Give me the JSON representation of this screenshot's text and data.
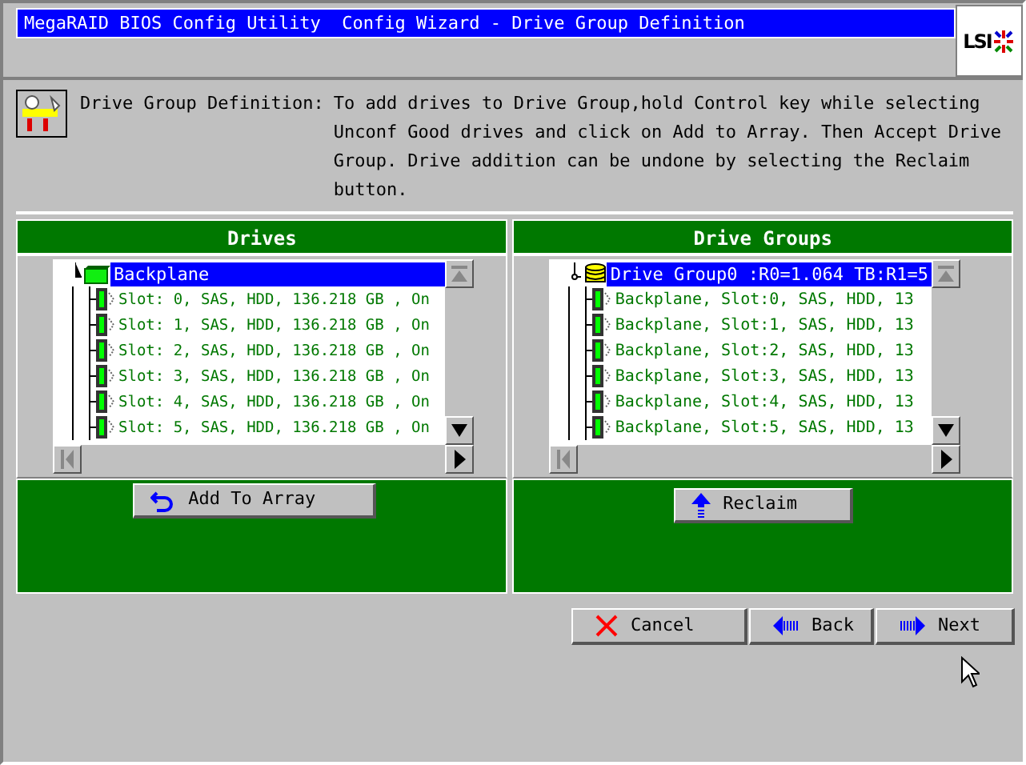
{
  "window": {
    "title": "MegaRAID BIOS Config Utility  Config Wizard - Drive Group Definition",
    "logo": "LSI"
  },
  "description": {
    "label": "Drive Group Definition:",
    "text": "To add drives to Drive Group,hold Control key while selecting Unconf Good drives and click on Add to Array. Then Accept Drive Group. Drive addition can be undone by selecting the Reclaim button."
  },
  "panels": [
    {
      "heading": "Drives",
      "tree": [
        {
          "label": "Backplane",
          "kind": "backplane",
          "selected": true,
          "children": [
            {
              "label": "Slot: 0, SAS, HDD, 136.218 GB , On",
              "kind": "drive",
              "selected": false
            },
            {
              "label": "Slot: 1, SAS, HDD, 136.218 GB , On",
              "kind": "drive",
              "selected": false
            },
            {
              "label": "Slot: 2, SAS, HDD, 136.218 GB , On",
              "kind": "drive",
              "selected": false
            },
            {
              "label": "Slot: 3, SAS, HDD, 136.218 GB , On",
              "kind": "drive",
              "selected": false
            },
            {
              "label": "Slot: 4, SAS, HDD, 136.218 GB , On",
              "kind": "drive",
              "selected": false
            },
            {
              "label": "Slot: 5, SAS, HDD, 136.218 GB , On",
              "kind": "drive",
              "selected": false
            }
          ]
        }
      ],
      "button": {
        "label": "Add To Array",
        "kind": "add"
      }
    },
    {
      "heading": "Drive Groups",
      "tree": [
        {
          "label": "Drive Group0 :R0=1.064 TB:R1=5",
          "kind": "group",
          "selected": true,
          "children": [
            {
              "label": "Backplane, Slot:0, SAS, HDD, 13",
              "kind": "drive",
              "selected": false
            },
            {
              "label": "Backplane, Slot:1, SAS, HDD, 13",
              "kind": "drive",
              "selected": false
            },
            {
              "label": "Backplane, Slot:2, SAS, HDD, 13",
              "kind": "drive",
              "selected": false
            },
            {
              "label": "Backplane, Slot:3, SAS, HDD, 13",
              "kind": "drive",
              "selected": false
            },
            {
              "label": "Backplane, Slot:4, SAS, HDD, 13",
              "kind": "drive",
              "selected": false
            },
            {
              "label": "Backplane, Slot:5, SAS, HDD, 13",
              "kind": "drive",
              "selected": false
            }
          ]
        }
      ],
      "button": {
        "label": "Reclaim",
        "kind": "reclaim"
      }
    }
  ],
  "buttons": [
    {
      "label": "Cancel",
      "kind": "cancel"
    },
    {
      "label": "Back",
      "kind": "back"
    },
    {
      "label": "Next",
      "kind": "next"
    }
  ]
}
